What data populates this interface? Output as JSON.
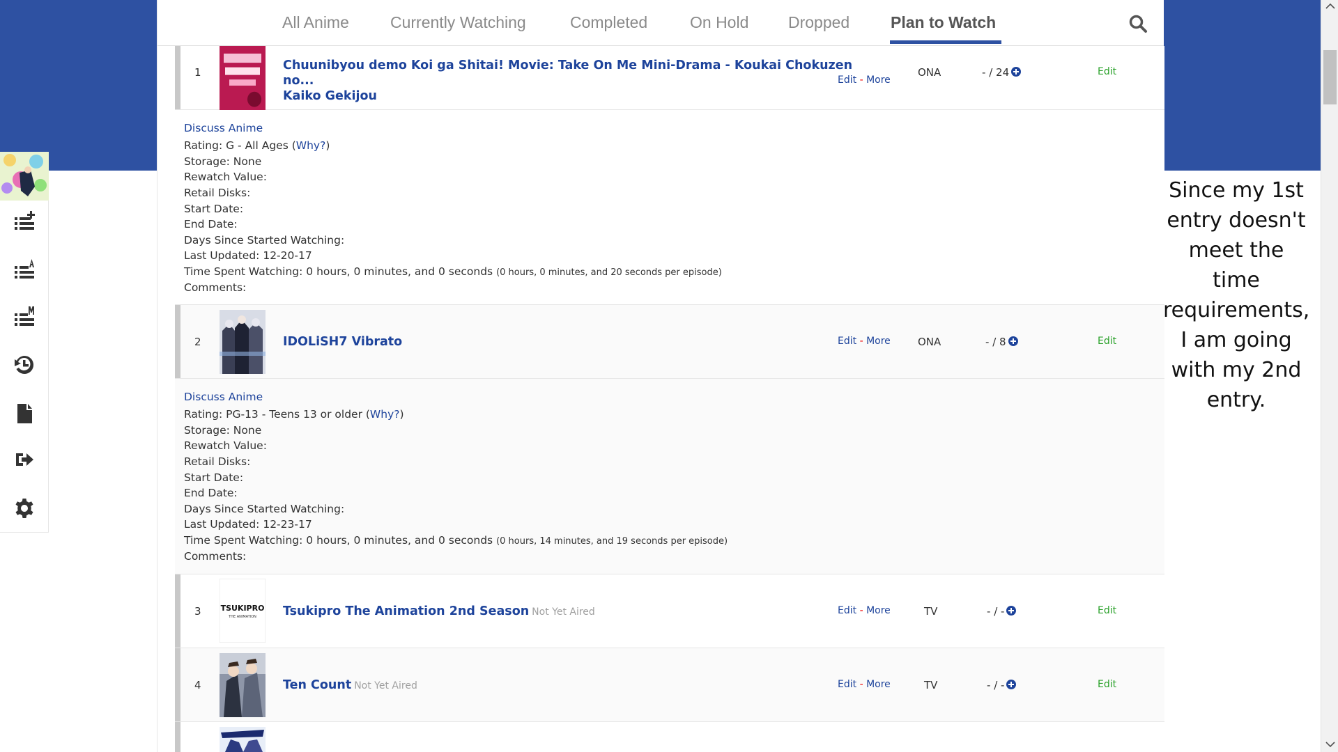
{
  "tabs": [
    {
      "label": "All Anime"
    },
    {
      "label": "Currently Watching"
    },
    {
      "label": "Completed"
    },
    {
      "label": "On Hold"
    },
    {
      "label": "Dropped"
    },
    {
      "label": "Plan to Watch",
      "active": true
    }
  ],
  "sidebar": {
    "items": [
      {
        "icon": "add-to-list-icon"
      },
      {
        "icon": "list-sort-alpha-icon"
      },
      {
        "icon": "list-manga-icon"
      },
      {
        "icon": "history-icon"
      },
      {
        "icon": "document-icon"
      },
      {
        "icon": "export-icon"
      },
      {
        "icon": "gear-icon"
      }
    ]
  },
  "entries": [
    {
      "num": "1",
      "title_line1": "Chuunibyou demo Koi ga Shitai! Movie: Take On Me Mini-Drama - Koukai Chokuzen no...",
      "title_line2": "Kaiko Gekijou",
      "edit_label": "Edit",
      "more_label": "More",
      "sep": "-",
      "type": "ONA",
      "progress_dash": "-",
      "progress_total": "/ 24",
      "edit_action": "Edit",
      "details": {
        "discuss": "Discuss Anime",
        "rating_prefix": "Rating: G - All Ages (",
        "why": "Why?",
        "rating_suffix": ")",
        "storage": "Storage: None",
        "rewatch": "Rewatch Value:",
        "retail": "Retail Disks:",
        "start": "Start Date:",
        "end": "End Date:",
        "days": "Days Since Started Watching:",
        "updated": "Last Updated: 12-20-17",
        "time_spent": "Time Spent Watching: 0 hours, 0 minutes, and 0 seconds",
        "time_per_ep": "(0 hours, 0 minutes, and 20 seconds per episode)",
        "comments": "Comments:"
      }
    },
    {
      "num": "2",
      "title": "IDOLiSH7 Vibrato",
      "edit_label": "Edit",
      "more_label": "More",
      "sep": "-",
      "type": "ONA",
      "progress_dash": "-",
      "progress_total": "/ 8",
      "edit_action": "Edit",
      "details": {
        "discuss": "Discuss Anime",
        "rating_prefix": "Rating: PG-13 - Teens 13 or older (",
        "why": "Why?",
        "rating_suffix": ")",
        "storage": "Storage: None",
        "rewatch": "Rewatch Value:",
        "retail": "Retail Disks:",
        "start": "Start Date:",
        "end": "End Date:",
        "days": "Days Since Started Watching:",
        "updated": "Last Updated: 12-23-17",
        "time_spent": "Time Spent Watching: 0 hours, 0 minutes, and 0 seconds",
        "time_per_ep": "(0 hours, 14 minutes, and 19 seconds per episode)",
        "comments": "Comments:"
      }
    },
    {
      "num": "3",
      "title": "Tsukipro The Animation 2nd Season",
      "status": "Not Yet Aired",
      "thumb_text": "TSUKIPRO",
      "thumb_sub": "THE ANIMATION",
      "edit_label": "Edit",
      "more_label": "More",
      "sep": "-",
      "type": "TV",
      "progress_dash": "-",
      "progress_total": "/ -",
      "edit_action": "Edit"
    },
    {
      "num": "4",
      "title": "Ten Count",
      "status": "Not Yet Aired",
      "edit_label": "Edit",
      "more_label": "More",
      "sep": "-",
      "type": "TV",
      "progress_dash": "-",
      "progress_total": "/ -",
      "edit_action": "Edit"
    }
  ],
  "note": "Since my 1st entry doesn't meet the time requirements, I am going with my 2nd entry.",
  "colors": {
    "brand_blue": "#2e51a2",
    "link_blue": "#1d439b",
    "edit_green": "#2aa12a"
  }
}
